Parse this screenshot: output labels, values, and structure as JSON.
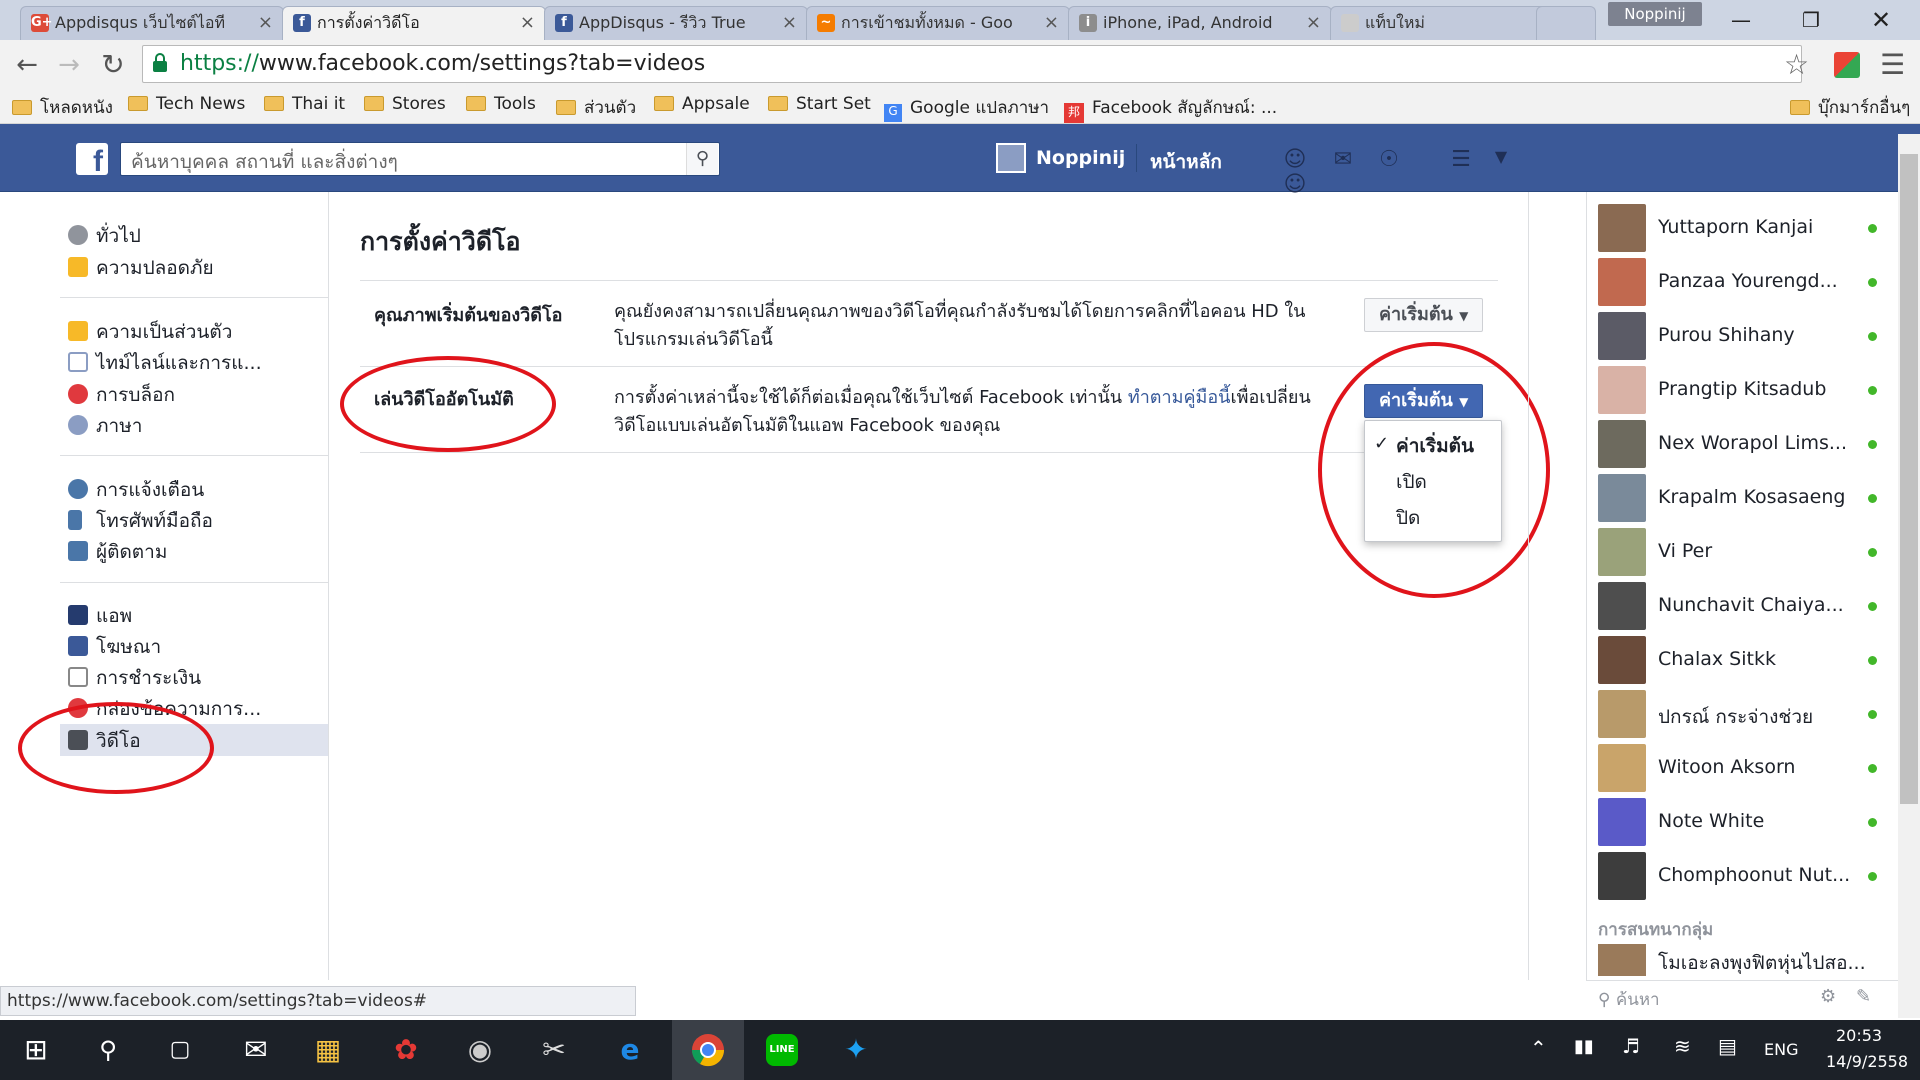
{
  "browser": {
    "tabs": [
      {
        "title": "Appdisqus เว็บไซต์ไอที",
        "favicon": "G+",
        "color": "#dd4b39"
      },
      {
        "title": "การตั้งค่าวิดีโอ",
        "favicon": "f",
        "color": "#3b5998"
      },
      {
        "title": "AppDisqus - รีวิว True",
        "favicon": "f",
        "color": "#3b5998"
      },
      {
        "title": "การเข้าชมทั้งหมด - Goo",
        "favicon": "~",
        "color": "#f57c00"
      },
      {
        "title": "iPhone, iPad, Android",
        "favicon": "i",
        "color": "#8d8d8d"
      },
      {
        "title": "แท็บใหม่",
        "favicon": "",
        "color": "#cccccc"
      }
    ],
    "profile_name": "Noppinij",
    "url_https": "https://",
    "url_rest": "www.facebook.com/settings?tab=videos",
    "bookmarks": [
      "โหลดหนัง",
      "Tech News",
      "Thai it",
      "Stores",
      "Tools",
      "ส่วนตัว",
      "Appsale",
      "Start Set",
      "Google แปลภาษา",
      "Facebook สัญลักษณ์: ..."
    ],
    "other_bookmarks": "บุ๊กมาร์กอื่นๆ"
  },
  "fb": {
    "search_placeholder": "ค้นหาบุคคล สถานที่ และสิ่งต่างๆ",
    "user_name": "Noppinij",
    "home_label": "หน้าหลัก"
  },
  "nav": {
    "general": "ทั่วไป",
    "security": "ความปลอดภัย",
    "privacy": "ความเป็นส่วนตัว",
    "timeline": "ไทม์ไลน์และการแ...",
    "blocking": "การบล็อก",
    "language": "ภาษา",
    "notifications": "การแจ้งเตือน",
    "mobile": "โทรศัพท์มือถือ",
    "followers": "ผู้ติดตาม",
    "apps": "แอพ",
    "ads": "โฆษณา",
    "payments": "การชำระเงิน",
    "support": "กล่องข้อความการ...",
    "videos": "วิดีโอ"
  },
  "settings": {
    "title": "การตั้งค่าวิดีโอ",
    "quality_label": "คุณภาพเริ่มต้นของวิดีโอ",
    "quality_desc": "คุณยังคงสามารถเปลี่ยนคุณภาพของวิดีโอที่คุณกำลังรับชมได้โดยการคลิกที่ไอคอน HD ในโปรแกรมเล่นวิดีโอนี้",
    "quality_value": "ค่าเริ่มต้น",
    "autoplay_label": "เล่นวิดีโออัตโนมัติ",
    "autoplay_desc_1": "การตั้งค่าเหล่านี้จะใช้ได้ก็ต่อเมื่อคุณใช้เว็บไซต์ Facebook เท่านั้น ",
    "autoplay_link": "ทำตามคู่มือนี้",
    "autoplay_desc_2": "เพื่อเปลี่ยนวิดีโอแบบเล่นอัตโนมัติในแอพ Facebook ของคุณ",
    "autoplay_value": "ค่าเริ่มต้น",
    "autoplay_options": [
      "ค่าเริ่มต้น",
      "เปิด",
      "ปิด"
    ]
  },
  "chat": {
    "contacts": [
      {
        "name": "Yuttaporn Kanjai",
        "avatar_color": "#8a6a52"
      },
      {
        "name": "Panzaa Yourengd...",
        "avatar_color": "#c1694f"
      },
      {
        "name": "Purou Shihany",
        "avatar_color": "#5b5b66"
      },
      {
        "name": "Prangtip Kitsadub",
        "avatar_color": "#d9b2a6"
      },
      {
        "name": "Nex Worapol Lims...",
        "avatar_color": "#6d6a5e"
      },
      {
        "name": "Krapalm Kosasaeng",
        "avatar_color": "#7a8a9a"
      },
      {
        "name": "Vi Per",
        "avatar_color": "#9aa27a"
      },
      {
        "name": "Nunchavit Chaiya...",
        "avatar_color": "#4e4e4e"
      },
      {
        "name": "Chalax Sitkk",
        "avatar_color": "#6a4b3a"
      },
      {
        "name": "ปกรณ์ กระจ่างช่วย",
        "avatar_color": "#b89a6a"
      },
      {
        "name": "Witoon Aksorn",
        "avatar_color": "#c9a46a"
      },
      {
        "name": "Note White",
        "avatar_color": "#5a5ac8"
      },
      {
        "name": "Chomphoonut Nut...",
        "avatar_color": "#3d3d3d"
      }
    ],
    "group_title": "การสนทนากลุ่ม",
    "group_name": "โมเอะลงพุงฟิตหุ่นไปสอ...",
    "search_placeholder": "ค้นหา"
  },
  "status_url": "https://www.facebook.com/settings?tab=videos#",
  "taskbar": {
    "lang": "ENG",
    "time": "20:53",
    "date": "14/9/2558"
  }
}
